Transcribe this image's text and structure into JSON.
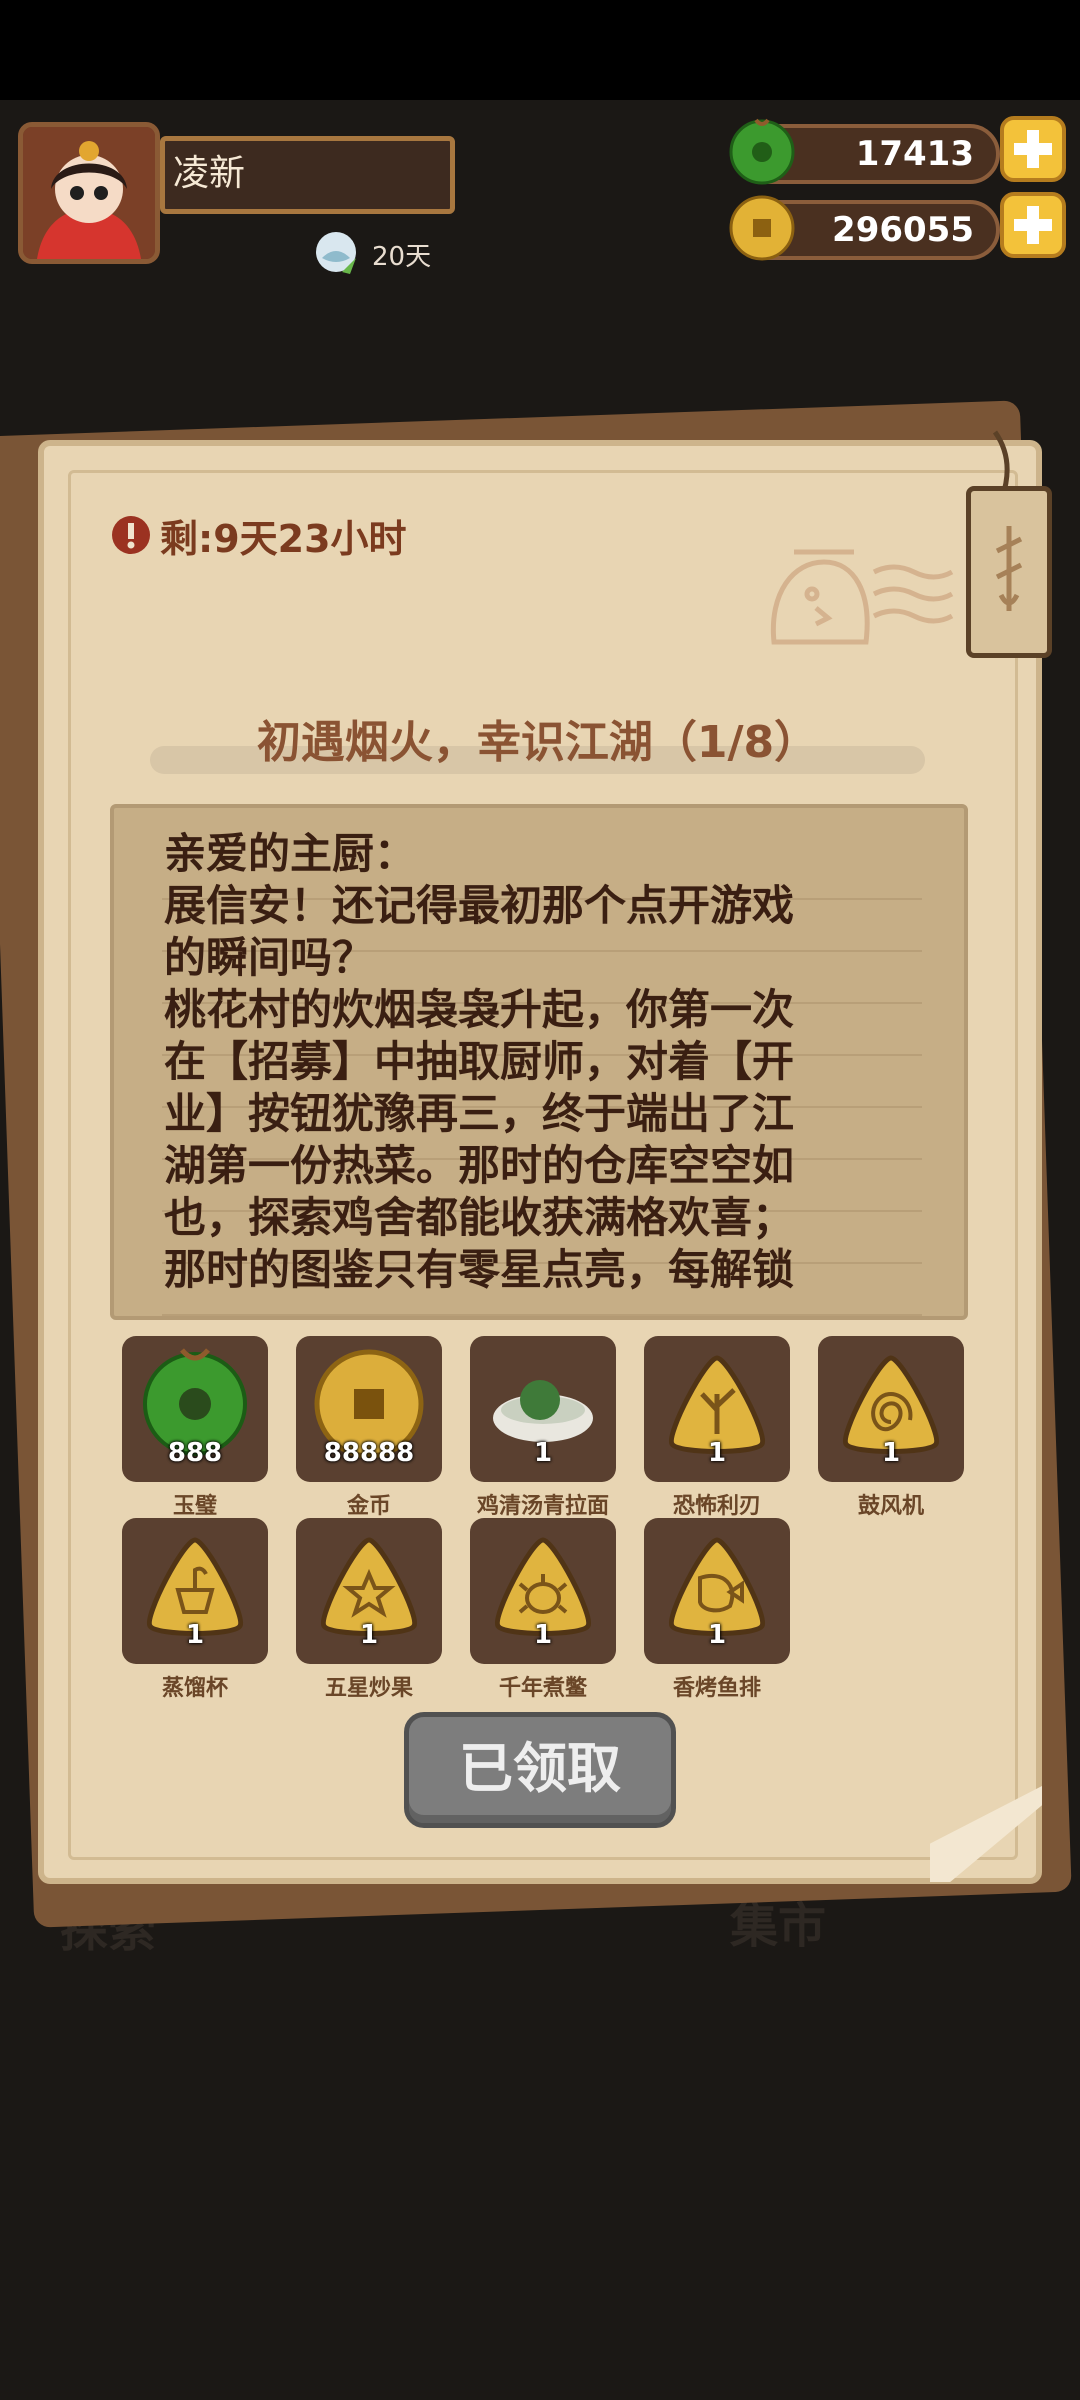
{
  "header": {
    "player_name": "凌新",
    "days_label": "20天",
    "jade_amount": "17413",
    "coin_amount": "296055"
  },
  "letter": {
    "timer_text": "剩:9天23小时",
    "title": "初遇烟火，幸识江湖（1/8）",
    "body": "亲爱的主厨：\n展信安！还记得最初那个点开游戏\n的瞬间吗？\n桃花村的炊烟袅袅升起，你第一次\n在【招募】中抽取厨师，对着【开\n业】按钮犹豫再三，终于端出了江\n湖第一份热菜。那时的仓库空空如\n也，探索鸡舍都能收获满格欢喜；\n那时的图鉴只有零星点亮，每解锁",
    "tag_icon": "stamp-tag-icon"
  },
  "rewards": [
    {
      "name": "玉璧",
      "count": "888",
      "icon": "jade-disc-icon"
    },
    {
      "name": "金币",
      "count": "88888",
      "icon": "gold-coin-icon"
    },
    {
      "name": "鸡清汤青拉面",
      "count": "1",
      "icon": "noodle-bowl-icon"
    },
    {
      "name": "恐怖利刃",
      "count": "1",
      "icon": "coral-ticket-icon"
    },
    {
      "name": "鼓风机",
      "count": "1",
      "icon": "spiral-ticket-icon"
    },
    {
      "name": "蒸馏杯",
      "count": "1",
      "icon": "cup-ticket-icon"
    },
    {
      "name": "五星炒果",
      "count": "1",
      "icon": "star-ticket-icon"
    },
    {
      "name": "千年煮鳖",
      "count": "1",
      "icon": "turtle-ticket-icon"
    },
    {
      "name": "香烤鱼排",
      "count": "1",
      "icon": "fish-ticket-icon"
    }
  ],
  "buttons": {
    "claimed_label": "已领取"
  },
  "background_hints": {
    "explore": "探索",
    "market": "集市"
  },
  "colors": {
    "panel": "#e8d5b3",
    "accent_text": "#8a5333",
    "reward_tile": "#5a4030",
    "button_disabled": "#7d7d7d"
  }
}
